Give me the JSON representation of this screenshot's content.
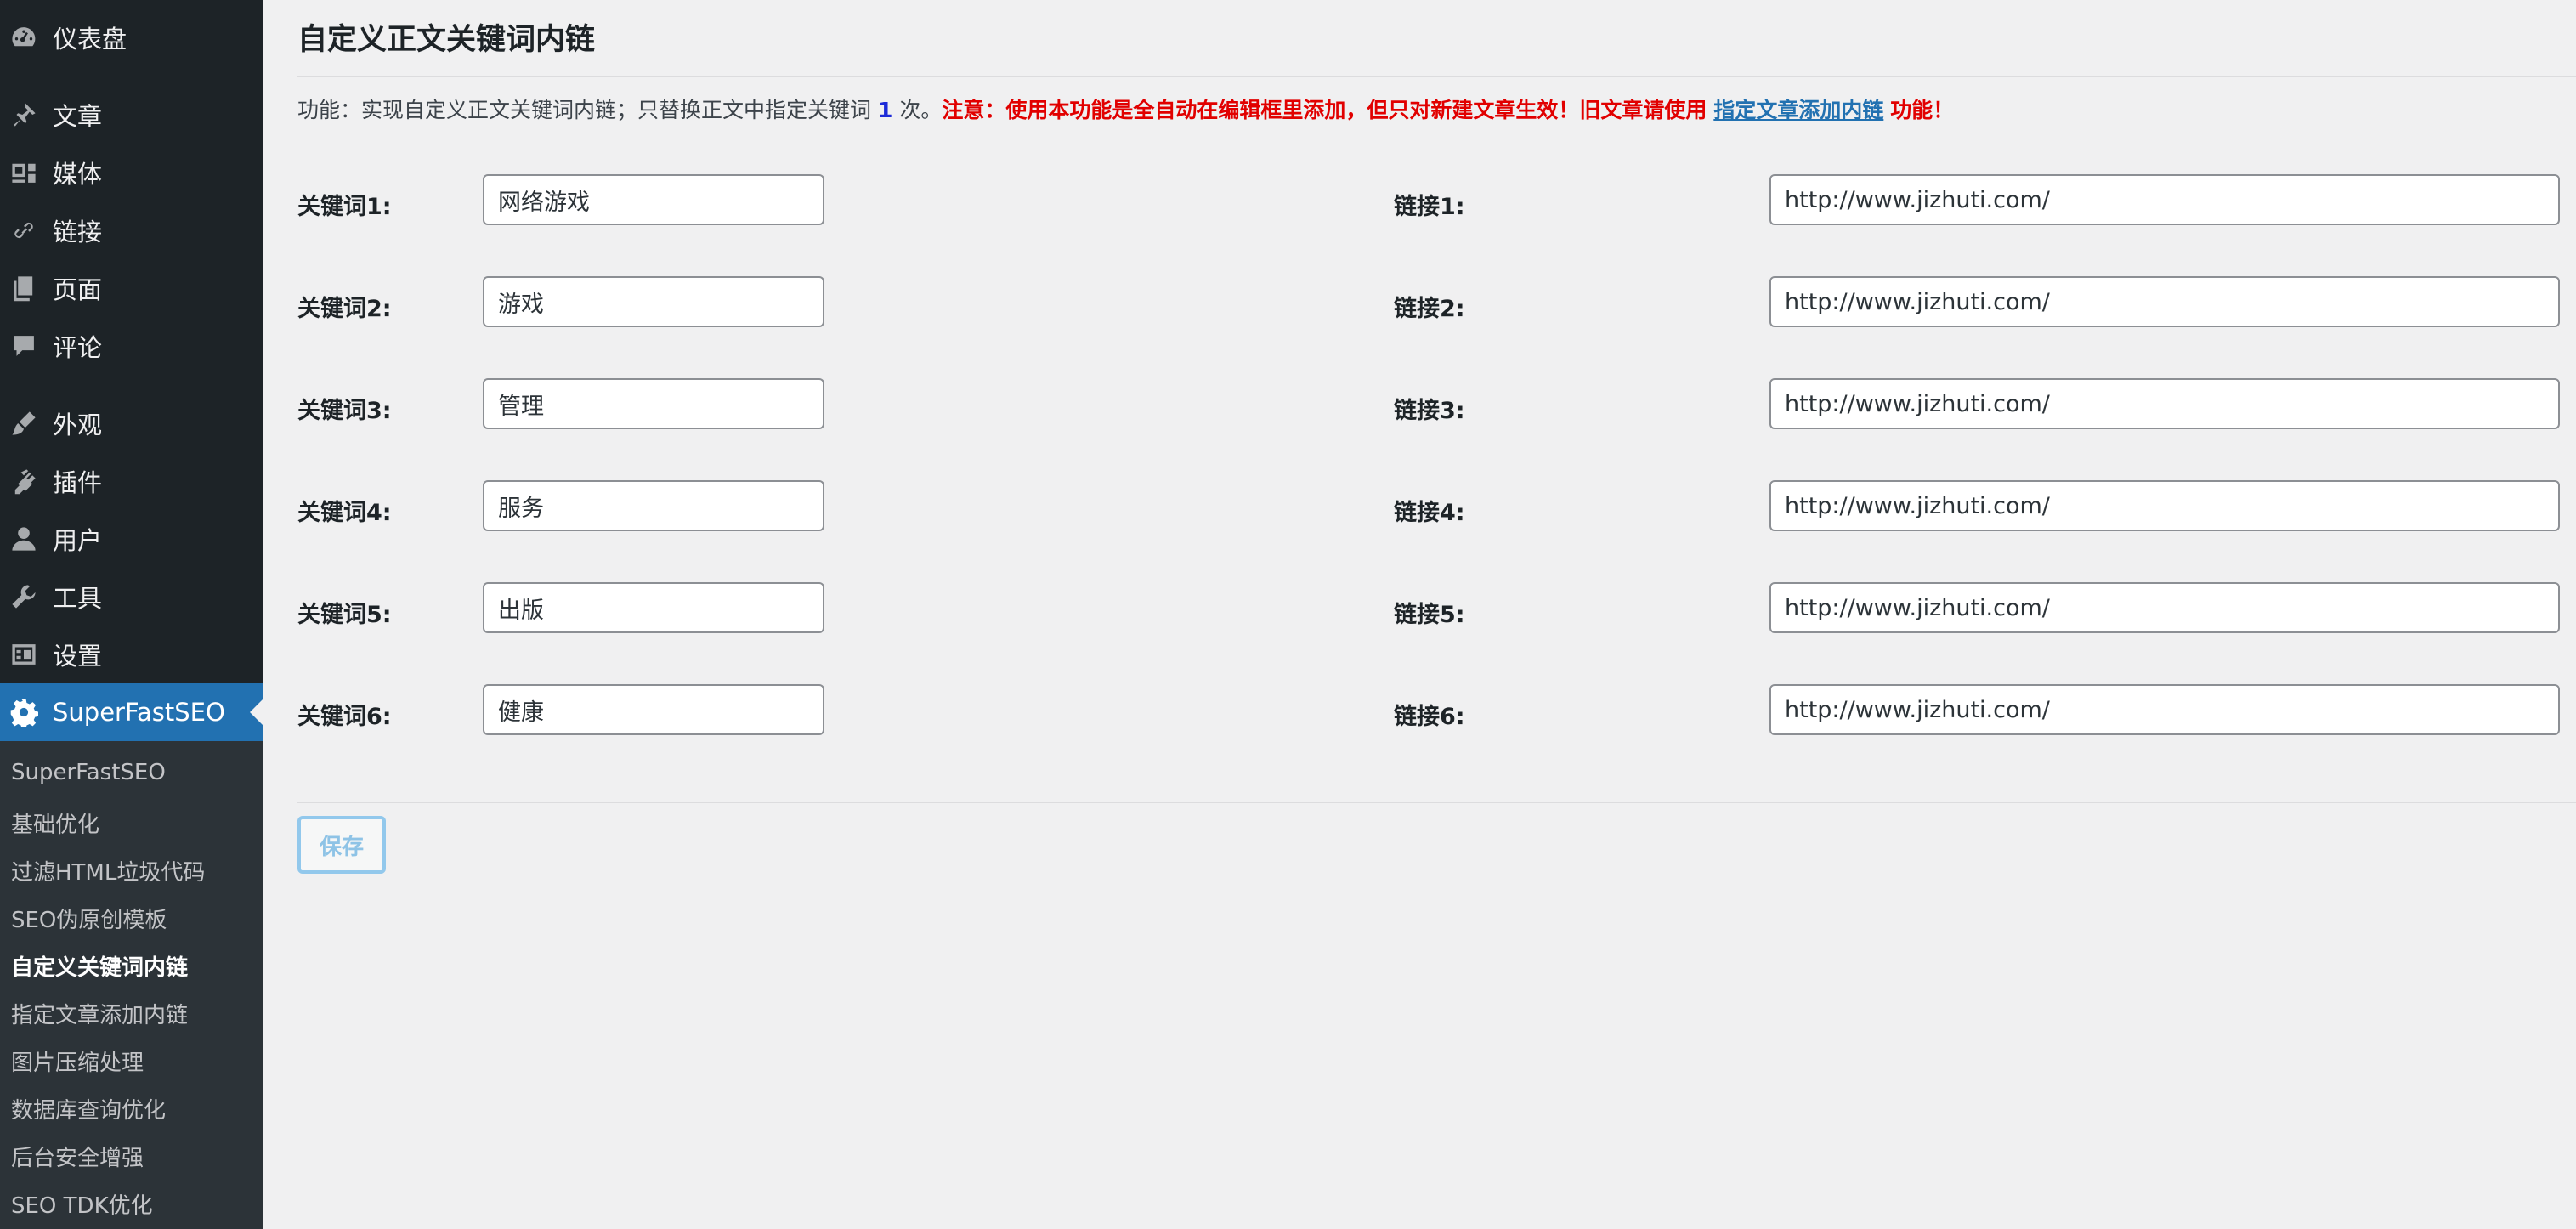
{
  "sidebar": {
    "items": [
      {
        "label": "仪表盘",
        "icon": "dashboard-icon"
      },
      {
        "label": "文章",
        "icon": "pushpin-icon"
      },
      {
        "label": "媒体",
        "icon": "media-icon"
      },
      {
        "label": "链接",
        "icon": "link-icon"
      },
      {
        "label": "页面",
        "icon": "page-icon"
      },
      {
        "label": "评论",
        "icon": "comment-icon"
      },
      {
        "label": "外观",
        "icon": "paintbrush-icon"
      },
      {
        "label": "插件",
        "icon": "plugin-icon"
      },
      {
        "label": "用户",
        "icon": "user-icon"
      },
      {
        "label": "工具",
        "icon": "wrench-icon"
      },
      {
        "label": "设置",
        "icon": "settings-icon"
      },
      {
        "label": "SuperFastSEO",
        "icon": "gear-icon",
        "active": true
      }
    ],
    "submenu": [
      {
        "label": "SuperFastSEO"
      },
      {
        "label": "基础优化"
      },
      {
        "label": "过滤HTML垃圾代码"
      },
      {
        "label": "SEO伪原创模板"
      },
      {
        "label": "自定义关键词内链",
        "current": true
      },
      {
        "label": "指定文章添加内链"
      },
      {
        "label": "图片压缩处理"
      },
      {
        "label": "数据库查询优化"
      },
      {
        "label": "后台安全增强"
      },
      {
        "label": "SEO TDK优化"
      }
    ]
  },
  "page": {
    "title": "自定义正文关键词内链",
    "desc_prefix": "功能：实现自定义正文关键词内链；只替换正文中指定关键词",
    "desc_count": "1",
    "desc_times": "次。",
    "desc_warning": "注意：使用本功能是全自动在编辑框里添加，但只对新建文章生效！旧文章请使用",
    "desc_link": "指定文章添加内链",
    "desc_suffix": "功能！"
  },
  "rows": [
    {
      "keyword_label": "关键词1:",
      "keyword": "网络游戏",
      "link_label": "链接1:",
      "link": "http://www.jizhuti.com/"
    },
    {
      "keyword_label": "关键词2:",
      "keyword": "游戏",
      "link_label": "链接2:",
      "link": "http://www.jizhuti.com/"
    },
    {
      "keyword_label": "关键词3:",
      "keyword": "管理",
      "link_label": "链接3:",
      "link": "http://www.jizhuti.com/"
    },
    {
      "keyword_label": "关键词4:",
      "keyword": "服务",
      "link_label": "链接4:",
      "link": "http://www.jizhuti.com/"
    },
    {
      "keyword_label": "关键词5:",
      "keyword": "出版",
      "link_label": "链接5:",
      "link": "http://www.jizhuti.com/"
    },
    {
      "keyword_label": "关键词6:",
      "keyword": "健康",
      "link_label": "链接6:",
      "link": "http://www.jizhuti.com/"
    }
  ],
  "save_label": "保存",
  "colors": {
    "sidebar_bg": "#1d2327",
    "submenu_bg": "#2c3338",
    "active_bg": "#2271b1",
    "warning": "#e10000",
    "count": "#1d2bd8"
  }
}
